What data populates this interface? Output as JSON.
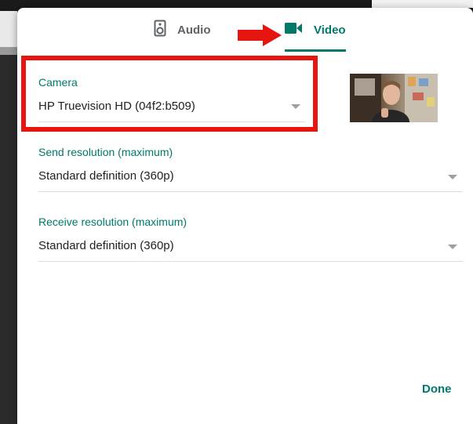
{
  "tabs": [
    {
      "label": "Audio",
      "icon": "speaker-icon",
      "active": false
    },
    {
      "label": "Video",
      "icon": "videocam-icon",
      "active": true
    }
  ],
  "camera": {
    "label": "Camera",
    "value": "HP Truevision HD (04f2:b509)"
  },
  "send_resolution": {
    "label": "Send resolution (maximum)",
    "value": "Standard definition (360p)"
  },
  "receive_resolution": {
    "label": "Receive resolution (maximum)",
    "value": "Standard definition (360p)"
  },
  "done_label": "Done",
  "colors": {
    "accent": "#00796b",
    "highlight": "#e6150f",
    "text": "#202124",
    "muted": "#5f6368"
  }
}
